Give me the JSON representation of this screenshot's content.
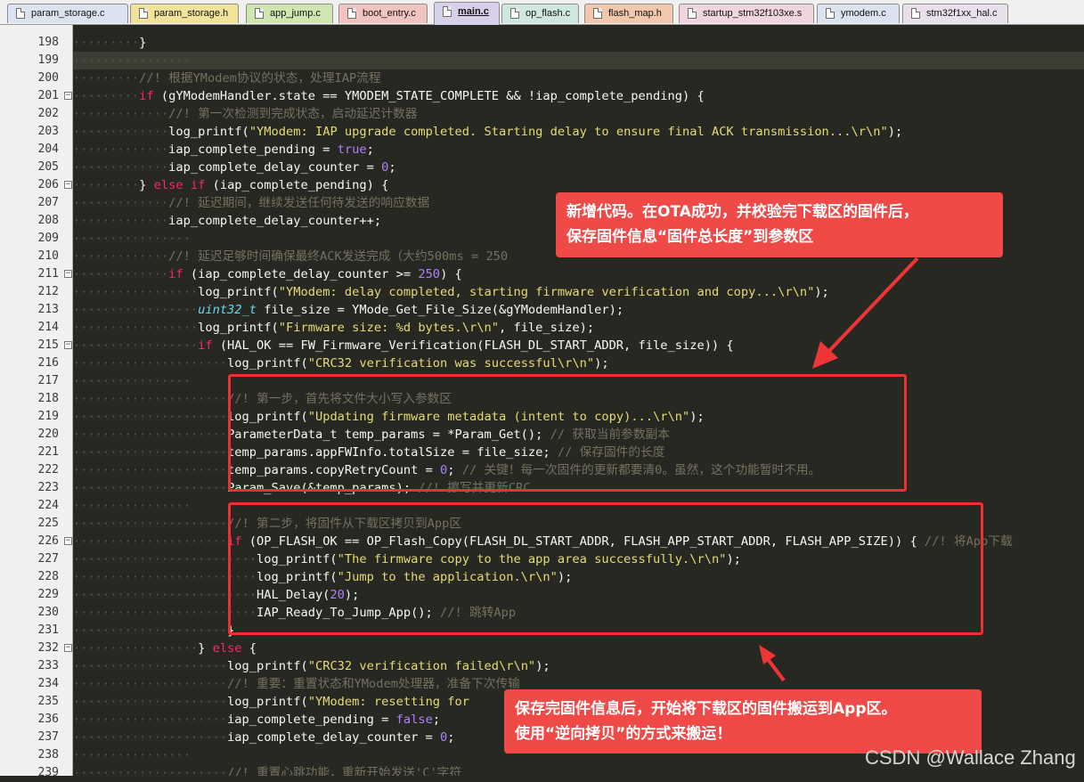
{
  "tabs": [
    {
      "label": "param_storage.c",
      "color": "#dce3f0",
      "active": false
    },
    {
      "label": "param_storage.h",
      "color": "#f2e39a",
      "active": false
    },
    {
      "label": "app_jump.c",
      "color": "#cfe6b0",
      "active": false
    },
    {
      "label": "boot_entry.c",
      "color": "#f2c4c0",
      "active": false
    },
    {
      "label": "main.c",
      "color": "#d8cfea",
      "active": true
    },
    {
      "label": "op_flash.c",
      "color": "#cfe8df",
      "active": false
    },
    {
      "label": "flash_map.h",
      "color": "#f2c7ad",
      "active": false
    },
    {
      "label": "startup_stm32f103xe.s",
      "color": "#f0d4df",
      "active": false
    },
    {
      "label": "ymodem.c",
      "color": "#dbe3f0",
      "active": false
    },
    {
      "label": "stm32f1xx_hal.c",
      "color": "#e8e0ea",
      "active": false
    }
  ],
  "code_lines": [
    {
      "num": "198",
      "indent": 2,
      "fold": false,
      "tokens": [
        [
          "p",
          "}"
        ]
      ]
    },
    {
      "num": "199",
      "indent": 0,
      "fold": false,
      "tokens": []
    },
    {
      "num": "200",
      "indent": 2,
      "fold": false,
      "tokens": [
        [
          "c",
          "//! 根据YModem协议的状态，处理IAP流程"
        ]
      ]
    },
    {
      "num": "201",
      "indent": 2,
      "fold": true,
      "tokens": [
        [
          "k",
          "if"
        ],
        [
          "p",
          " (gYModemHandler.state == YMODEM_STATE_COMPLETE && !iap_complete_pending) {"
        ]
      ]
    },
    {
      "num": "202",
      "indent": 3,
      "fold": false,
      "tokens": [
        [
          "c",
          "//! 第一次检测到完成状态，启动延迟计数器"
        ]
      ]
    },
    {
      "num": "203",
      "indent": 3,
      "fold": false,
      "tokens": [
        [
          "p",
          "log_printf("
        ],
        [
          "s",
          "\"YModem: IAP upgrade completed. Starting delay to ensure final ACK transmission...\\r\\n\""
        ],
        [
          "p",
          ");"
        ]
      ]
    },
    {
      "num": "204",
      "indent": 3,
      "fold": false,
      "tokens": [
        [
          "p",
          "iap_complete_pending = "
        ],
        [
          "n",
          "true"
        ],
        [
          "p",
          ";"
        ]
      ]
    },
    {
      "num": "205",
      "indent": 3,
      "fold": false,
      "tokens": [
        [
          "p",
          "iap_complete_delay_counter = "
        ],
        [
          "n",
          "0"
        ],
        [
          "p",
          ";"
        ]
      ]
    },
    {
      "num": "206",
      "indent": 2,
      "fold": true,
      "tokens": [
        [
          "p",
          "} "
        ],
        [
          "k",
          "else if"
        ],
        [
          "p",
          " (iap_complete_pending) {"
        ]
      ]
    },
    {
      "num": "207",
      "indent": 3,
      "fold": false,
      "tokens": [
        [
          "c",
          "//! 延迟期间，继续发送任何待发送的响应数据"
        ]
      ]
    },
    {
      "num": "208",
      "indent": 3,
      "fold": false,
      "tokens": [
        [
          "p",
          "iap_complete_delay_counter++;"
        ]
      ]
    },
    {
      "num": "209",
      "indent": 0,
      "fold": false,
      "tokens": []
    },
    {
      "num": "210",
      "indent": 3,
      "fold": false,
      "tokens": [
        [
          "c",
          "//! 延迟足够时间确保最终ACK发送完成（大约500ms = 250"
        ]
      ]
    },
    {
      "num": "211",
      "indent": 3,
      "fold": true,
      "tokens": [
        [
          "k",
          "if"
        ],
        [
          "p",
          " (iap_complete_delay_counter >= "
        ],
        [
          "n",
          "250"
        ],
        [
          "p",
          ") {"
        ]
      ]
    },
    {
      "num": "212",
      "indent": 4,
      "fold": false,
      "tokens": [
        [
          "p",
          "log_printf("
        ],
        [
          "s",
          "\"YModem: delay completed, starting firmware verification and copy...\\r\\n\""
        ],
        [
          "p",
          ");"
        ]
      ]
    },
    {
      "num": "213",
      "indent": 4,
      "fold": false,
      "tokens": [
        [
          "t",
          "uint32_t"
        ],
        [
          "p",
          " file_size = YMode_Get_File_Size(&gYModemHandler);"
        ]
      ]
    },
    {
      "num": "214",
      "indent": 4,
      "fold": false,
      "tokens": [
        [
          "p",
          "log_printf("
        ],
        [
          "s",
          "\"Firmware size: %d bytes.\\r\\n\""
        ],
        [
          "p",
          ", file_size);"
        ]
      ]
    },
    {
      "num": "215",
      "indent": 4,
      "fold": true,
      "tokens": [
        [
          "k",
          "if"
        ],
        [
          "p",
          " (HAL_OK == FW_Firmware_Verification(FLASH_DL_START_ADDR, file_size)) {"
        ]
      ]
    },
    {
      "num": "216",
      "indent": 5,
      "fold": false,
      "tokens": [
        [
          "p",
          "log_printf("
        ],
        [
          "s",
          "\"CRC32 verification was successful\\r\\n\""
        ],
        [
          "p",
          ");"
        ]
      ]
    },
    {
      "num": "217",
      "indent": 0,
      "fold": false,
      "tokens": []
    },
    {
      "num": "218",
      "indent": 5,
      "fold": false,
      "tokens": [
        [
          "c",
          "//! 第一步，首先将文件大小写入参数区"
        ]
      ]
    },
    {
      "num": "219",
      "indent": 5,
      "fold": false,
      "tokens": [
        [
          "p",
          "log_printf("
        ],
        [
          "s",
          "\"Updating firmware metadata (intent to copy)...\\r\\n\""
        ],
        [
          "p",
          ");"
        ]
      ]
    },
    {
      "num": "220",
      "indent": 5,
      "fold": false,
      "tokens": [
        [
          "p",
          "ParameterData_t temp_params = *Param_Get(); "
        ],
        [
          "c",
          "// 获取当前参数副本"
        ]
      ]
    },
    {
      "num": "221",
      "indent": 5,
      "fold": false,
      "tokens": [
        [
          "p",
          "temp_params.appFWInfo.totalSize = file_size; "
        ],
        [
          "c",
          "// 保存固件的长度"
        ]
      ]
    },
    {
      "num": "222",
      "indent": 5,
      "fold": false,
      "tokens": [
        [
          "p",
          "temp_params.copyRetryCount = "
        ],
        [
          "n",
          "0"
        ],
        [
          "p",
          "; "
        ],
        [
          "c",
          "// 关键！每一次固件的更新都要清0。虽然，这个功能暂时不用。"
        ]
      ]
    },
    {
      "num": "223",
      "indent": 5,
      "fold": false,
      "tokens": [
        [
          "p",
          "Param_Save(&temp_params); "
        ],
        [
          "c",
          "//! 擦写并更新CRC"
        ]
      ]
    },
    {
      "num": "224",
      "indent": 0,
      "fold": false,
      "tokens": []
    },
    {
      "num": "225",
      "indent": 5,
      "fold": false,
      "tokens": [
        [
          "c",
          "//! 第二步，将固件从下载区拷贝到App区"
        ]
      ]
    },
    {
      "num": "226",
      "indent": 5,
      "fold": true,
      "tokens": [
        [
          "k",
          "if"
        ],
        [
          "p",
          " (OP_FLASH_OK == OP_Flash_Copy(FLASH_DL_START_ADDR, FLASH_APP_START_ADDR, FLASH_APP_SIZE)) { "
        ],
        [
          "c",
          "//! 将App下载"
        ]
      ]
    },
    {
      "num": "227",
      "indent": 6,
      "fold": false,
      "tokens": [
        [
          "p",
          "log_printf("
        ],
        [
          "s",
          "\"The firmware copy to the app area successfully.\\r\\n\""
        ],
        [
          "p",
          ");"
        ]
      ]
    },
    {
      "num": "228",
      "indent": 6,
      "fold": false,
      "tokens": [
        [
          "p",
          "log_printf("
        ],
        [
          "s",
          "\"Jump to the application.\\r\\n\""
        ],
        [
          "p",
          ");"
        ]
      ]
    },
    {
      "num": "229",
      "indent": 6,
      "fold": false,
      "tokens": [
        [
          "p",
          "HAL_Delay("
        ],
        [
          "n",
          "20"
        ],
        [
          "p",
          ");"
        ]
      ]
    },
    {
      "num": "230",
      "indent": 6,
      "fold": false,
      "tokens": [
        [
          "p",
          "IAP_Ready_To_Jump_App(); "
        ],
        [
          "c",
          "//! 跳转App"
        ]
      ]
    },
    {
      "num": "231",
      "indent": 5,
      "fold": false,
      "tokens": [
        [
          "p",
          "}"
        ]
      ]
    },
    {
      "num": "232",
      "indent": 4,
      "fold": true,
      "tokens": [
        [
          "p",
          "} "
        ],
        [
          "k",
          "else"
        ],
        [
          "p",
          " {"
        ]
      ]
    },
    {
      "num": "233",
      "indent": 5,
      "fold": false,
      "tokens": [
        [
          "p",
          "log_printf("
        ],
        [
          "s",
          "\"CRC32 verification failed\\r\\n\""
        ],
        [
          "p",
          ");"
        ]
      ]
    },
    {
      "num": "234",
      "indent": 5,
      "fold": false,
      "tokens": [
        [
          "c",
          "//! 重要：重置状态和YModem处理器，准备下次传输"
        ]
      ]
    },
    {
      "num": "235",
      "indent": 5,
      "fold": false,
      "tokens": [
        [
          "p",
          "log_printf("
        ],
        [
          "s",
          "\"YModem: resetting for"
        ]
      ]
    },
    {
      "num": "236",
      "indent": 5,
      "fold": false,
      "tokens": [
        [
          "p",
          "iap_complete_pending = "
        ],
        [
          "n",
          "false"
        ],
        [
          "p",
          ";"
        ]
      ]
    },
    {
      "num": "237",
      "indent": 5,
      "fold": false,
      "tokens": [
        [
          "p",
          "iap_complete_delay_counter = "
        ],
        [
          "n",
          "0"
        ],
        [
          "p",
          ";"
        ]
      ]
    },
    {
      "num": "238",
      "indent": 0,
      "fold": false,
      "tokens": []
    },
    {
      "num": "239",
      "indent": 5,
      "fold": false,
      "tokens": [
        [
          "c",
          "//! 重置心跳功能，重新开始发送'C'字符"
        ]
      ]
    }
  ],
  "annotations": {
    "callout_top_line1": "新增代码。在OTA成功，并校验完下载区的固件后，",
    "callout_top_line2": "保存固件信息“固件总长度”到参数区",
    "callout_bottom_line1": "保存完固件信息后，开始将下载区的固件搬运到App区。",
    "callout_bottom_line2": "使用“逆向拷贝”的方式来搬运！"
  },
  "watermark": "CSDN @Wallace Zhang",
  "colors": {
    "editor_bg": "#272822",
    "keyword": "#f92672",
    "string": "#e6db74",
    "number": "#ae81ff",
    "comment": "#75715e",
    "type": "#66d9ef",
    "annotation_red": "#ef2f2f",
    "callout_bg": "#ef4a48"
  }
}
